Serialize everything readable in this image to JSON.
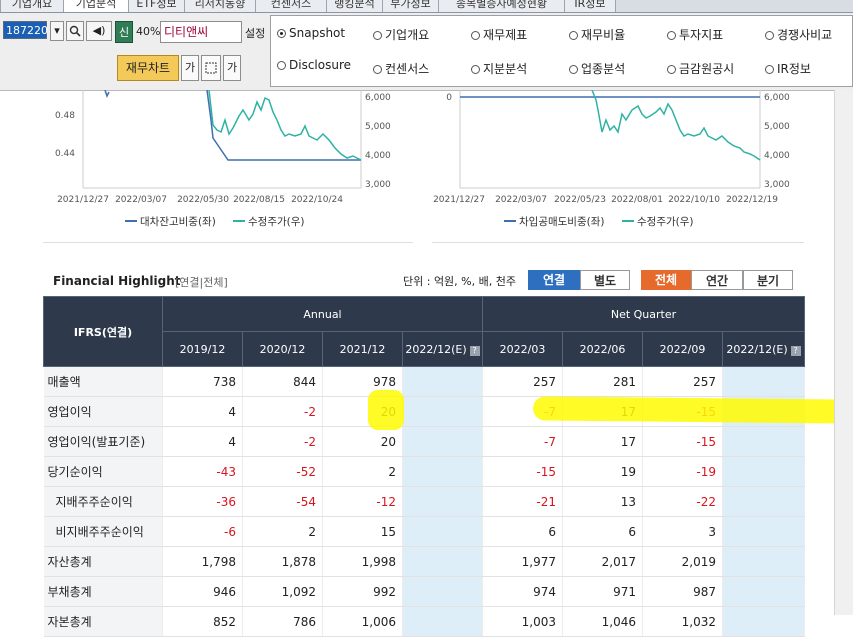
{
  "top_tabs": [
    "기업개요",
    "기업분석",
    "ETF정보",
    "리서치동향",
    "컨센서스",
    "랭킹분석",
    "부가정보",
    "종목별증자예정현황",
    "IR정보"
  ],
  "toolbar": {
    "stock_code": "187220",
    "market_badge": "신",
    "margin_rate": "40%",
    "company_name": "디티앤씨",
    "setting_label": "설정",
    "chart_button": "재무차트",
    "font_up_label": "가",
    "font_down_label": "가"
  },
  "menu": [
    {
      "label": "Snapshot",
      "selected": true
    },
    {
      "label": "기업개요",
      "selected": false
    },
    {
      "label": "재무제표",
      "selected": false
    },
    {
      "label": "재무비율",
      "selected": false
    },
    {
      "label": "투자지표",
      "selected": false
    },
    {
      "label": "경쟁사비교",
      "selected": false
    },
    {
      "label": "Disclosure",
      "selected": false
    },
    {
      "label": "컨센서스",
      "selected": false
    },
    {
      "label": "지분분석",
      "selected": false
    },
    {
      "label": "업종분석",
      "selected": false
    },
    {
      "label": "금감원공시",
      "selected": false
    },
    {
      "label": "IR정보",
      "selected": false
    }
  ],
  "chart_data": [
    {
      "type": "line",
      "x_ticks": [
        "2021/12/27",
        "2022/03/07",
        "2022/05/30",
        "2022/08/15",
        "2022/10/24"
      ],
      "y_left_ticks": [
        "0.48",
        "0.44"
      ],
      "y_right_ticks": [
        "6,000",
        "5,000",
        "4,000",
        "3,000"
      ],
      "series": [
        {
          "name": "대차잔고비중(좌)",
          "color": "#3e6fb0"
        },
        {
          "name": "수정주가(우)",
          "color": "#2eb2a5"
        }
      ]
    },
    {
      "type": "line",
      "x_ticks": [
        "2021/12/27",
        "2022/03/07",
        "2022/05/23",
        "2022/08/01",
        "2022/10/10",
        "2022/12/19"
      ],
      "y_left_ticks": [
        "0"
      ],
      "y_right_ticks": [
        "6,000",
        "5,000",
        "4,000",
        "3,000"
      ],
      "series": [
        {
          "name": "차입공매도비중(좌)",
          "color": "#3e6fb0"
        },
        {
          "name": "수정주가(우)",
          "color": "#2eb2a5"
        }
      ]
    }
  ],
  "financial": {
    "title": "Financial Highlight",
    "subtitle": "[연결|전체]",
    "unit": "단위 : 억원, %, 배, 천주",
    "btn_consolidated": "연결",
    "btn_separate": "별도",
    "btn_all": "전체",
    "btn_annual": "연간",
    "btn_quarter": "분기",
    "header_first": "IFRS(연결)",
    "header_annual": "Annual",
    "header_quarter": "Net Quarter",
    "columns": [
      "2019/12",
      "2020/12",
      "2021/12",
      "2022/12(E)",
      "2022/03",
      "2022/06",
      "2022/09",
      "2022/12(E)"
    ],
    "rows": [
      {
        "label": "매출액",
        "indent": false,
        "values": [
          "738",
          "844",
          "978",
          "",
          "257",
          "281",
          "257",
          ""
        ]
      },
      {
        "label": "영업이익",
        "indent": false,
        "values": [
          "4",
          "-2",
          "20",
          "",
          "-7",
          "17",
          "-15",
          ""
        ]
      },
      {
        "label": "영업이익(발표기준)",
        "indent": false,
        "values": [
          "4",
          "-2",
          "20",
          "",
          "-7",
          "17",
          "-15",
          ""
        ]
      },
      {
        "label": "당기순이익",
        "indent": false,
        "values": [
          "-43",
          "-52",
          "2",
          "",
          "-15",
          "19",
          "-19",
          ""
        ]
      },
      {
        "label": "지배주주순이익",
        "indent": true,
        "values": [
          "-36",
          "-54",
          "-12",
          "",
          "-21",
          "13",
          "-22",
          ""
        ]
      },
      {
        "label": "비지배주주순이익",
        "indent": true,
        "values": [
          "-6",
          "2",
          "15",
          "",
          "6",
          "6",
          "3",
          ""
        ]
      },
      {
        "label": "자산총계",
        "indent": false,
        "values": [
          "1,798",
          "1,878",
          "1,998",
          "",
          "1,977",
          "2,017",
          "2,019",
          ""
        ]
      },
      {
        "label": "부채총계",
        "indent": false,
        "values": [
          "946",
          "1,092",
          "992",
          "",
          "974",
          "971",
          "987",
          ""
        ]
      },
      {
        "label": "자본총계",
        "indent": false,
        "values": [
          "852",
          "786",
          "1,006",
          "",
          "1,003",
          "1,046",
          "1,032",
          ""
        ]
      }
    ]
  }
}
